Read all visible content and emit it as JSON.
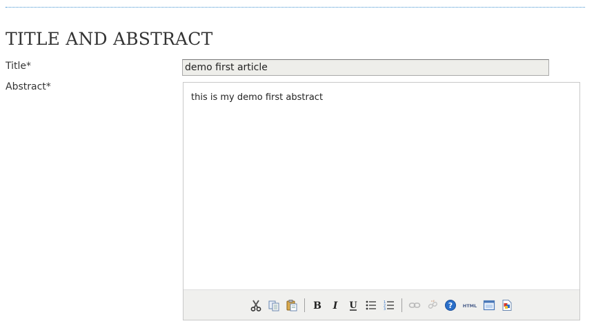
{
  "section": {
    "title": "TITLE AND ABSTRACT"
  },
  "fields": {
    "title_label": "Title*",
    "title_value": "demo first article",
    "abstract_label": "Abstract*",
    "abstract_value": "this is my demo first abstract"
  },
  "toolbar": {
    "buttons": [
      {
        "icon": "cut-icon"
      },
      {
        "icon": "copy-icon"
      },
      {
        "icon": "paste-icon"
      },
      {
        "icon": "bold-icon",
        "glyph": "B"
      },
      {
        "icon": "italic-icon",
        "glyph": "I"
      },
      {
        "icon": "underline-icon",
        "glyph": "U"
      },
      {
        "icon": "bullet-list-icon"
      },
      {
        "icon": "numbered-list-icon"
      },
      {
        "icon": "link-icon"
      },
      {
        "icon": "unlink-icon"
      },
      {
        "icon": "help-icon",
        "glyph": "?"
      },
      {
        "icon": "html-source-icon",
        "glyph": "HTML"
      },
      {
        "icon": "fullscreen-icon"
      },
      {
        "icon": "paste-word-icon"
      }
    ],
    "colors": {
      "accent": "#3a8fd0",
      "help_blue": "#2a6fc9",
      "icon_gray": "#555555"
    }
  }
}
